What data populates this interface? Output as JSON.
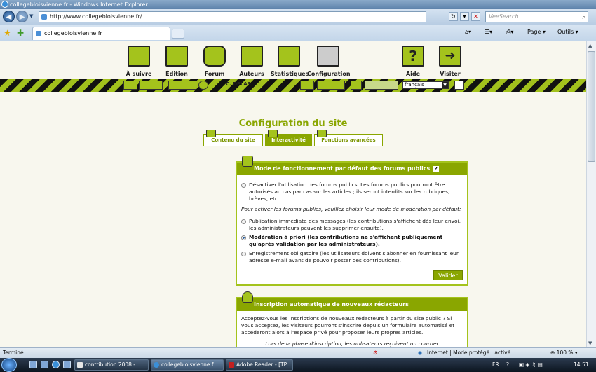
{
  "window": {
    "title": "collegebloisvienne.fr - Windows Internet Explorer"
  },
  "browser": {
    "url": "http://www.collegebloisvienne.fr/",
    "search_placeholder": "VeeSearch",
    "tab_title": "collegebloisvienne.fr",
    "page_menu": "Page",
    "tools_menu": "Outils"
  },
  "nav": {
    "items": [
      {
        "label": "À suivre"
      },
      {
        "label": "Édition"
      },
      {
        "label": "Forum"
      },
      {
        "label": "Auteurs"
      },
      {
        "label": "Statistiques"
      },
      {
        "label": "Configuration"
      },
      {
        "label": "Aide"
      },
      {
        "label": "Visiter"
      }
    ],
    "author": "C. DELAS",
    "language": "français"
  },
  "page": {
    "title": "Configuration du site",
    "tabs": [
      {
        "label": "Contenu du site"
      },
      {
        "label": "Interactivité"
      },
      {
        "label": "Fonctions avancées"
      }
    ]
  },
  "forum_panel": {
    "title": "Mode de fonctionnement par défaut des forums publics",
    "help": "?",
    "option_disable": "Désactiver l'utilisation des forums publics. Les forums publics pourront être autorisés au cas par cas sur les articles ; ils seront interdits sur les rubriques, brèves, etc.",
    "note": "Pour activer les forums publics, veuillez choisir leur mode de modération par défaut:",
    "option_immediate": "Publication immédiate des messages (les contributions s'affichent dès leur envoi, les administrateurs peuvent les supprimer ensuite).",
    "option_moderation": "Modération à priori (les contributions ne s'affichent publiquement qu'après validation par les administrateurs).",
    "option_register": "Enregistrement obligatoire (les utilisateurs doivent s'abonner en fournissant leur adresse e-mail avant de pouvoir poster des contributions).",
    "submit": "Valider"
  },
  "signup_panel": {
    "title": "Inscription automatique de nouveaux rédacteurs",
    "text": "Acceptez-vous les inscriptions de nouveaux rédacteurs à partir du site public ? Si vous acceptez, les visiteurs pourront s'inscrire depuis un formulaire automatisé et accéderont alors à l'espace privé pour proposer leurs propres articles.",
    "note": "Lors de la phase d'inscription, les utilisateurs reçoivent un courrier"
  },
  "statusbar": {
    "status": "Terminé",
    "zone": "Internet | Mode protégé : activé",
    "zoom": "100 %"
  },
  "taskbar": {
    "tasks": [
      {
        "label": "contribution 2008 - ..."
      },
      {
        "label": "collegebloisvienne.f..."
      },
      {
        "label": "Adobe Reader - [TP..."
      }
    ],
    "lang": "FR",
    "time": "14:51"
  }
}
